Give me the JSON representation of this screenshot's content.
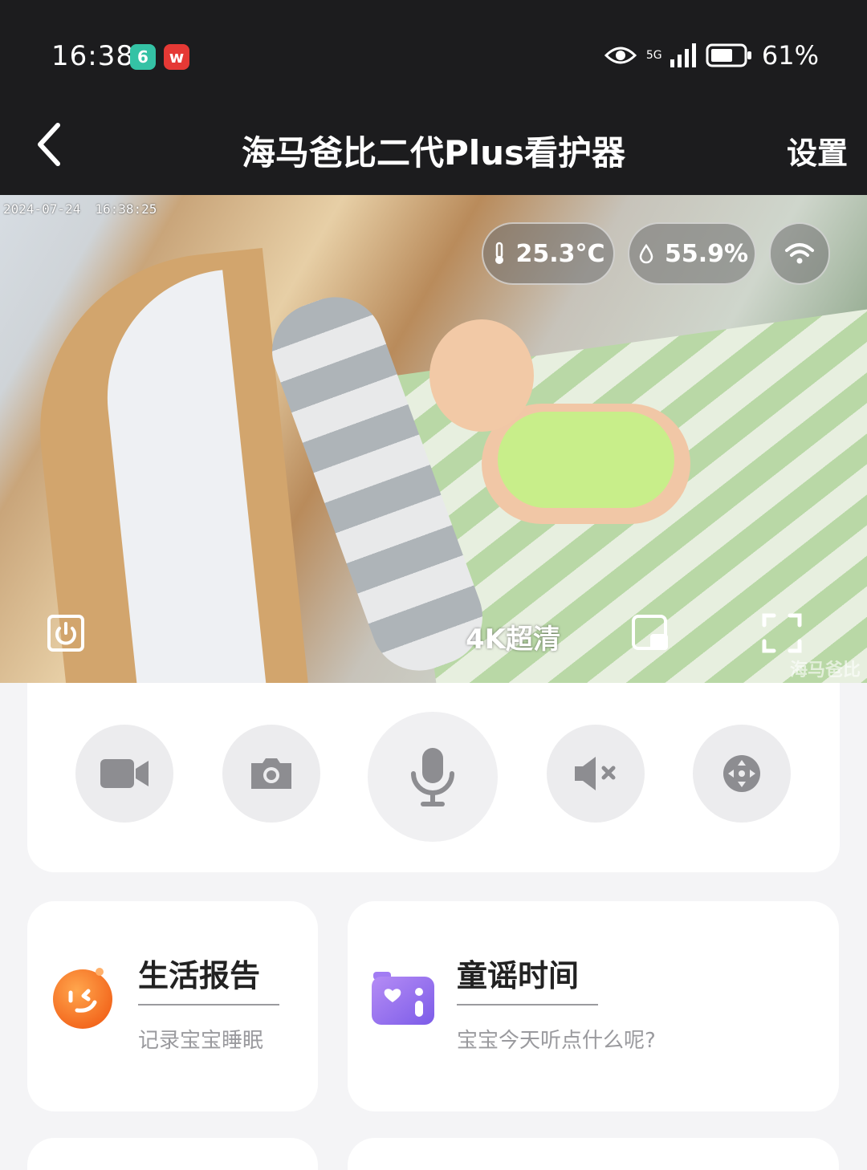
{
  "status_bar": {
    "time": "16:38",
    "app_badges": [
      {
        "letter": "6",
        "color": "#34c2a5"
      },
      {
        "letter": "w",
        "color": "#e53935"
      }
    ],
    "network": "5G",
    "battery": "61%"
  },
  "nav": {
    "title": "海马爸比二代Plus看护器",
    "settings_label": "设置"
  },
  "video": {
    "timestamp_date": "2024-07-24",
    "timestamp_time": "16:38:25",
    "temperature": "25.3°C",
    "humidity": "55.9%",
    "quality_label": "4K超清",
    "watermark": "海马爸比"
  },
  "controls": {
    "icons": [
      "video-record-icon",
      "camera-icon",
      "microphone-icon",
      "speaker-mute-icon",
      "pan-tilt-icon"
    ]
  },
  "features": {
    "life_report": {
      "title": "生活报告",
      "subtitle": "记录宝宝睡眠",
      "accent": "#f46f1d"
    },
    "nursery_rhymes": {
      "title": "童谣时间",
      "subtitle": "宝宝今天听点什么呢?",
      "accent": "#8a6cf0"
    }
  }
}
